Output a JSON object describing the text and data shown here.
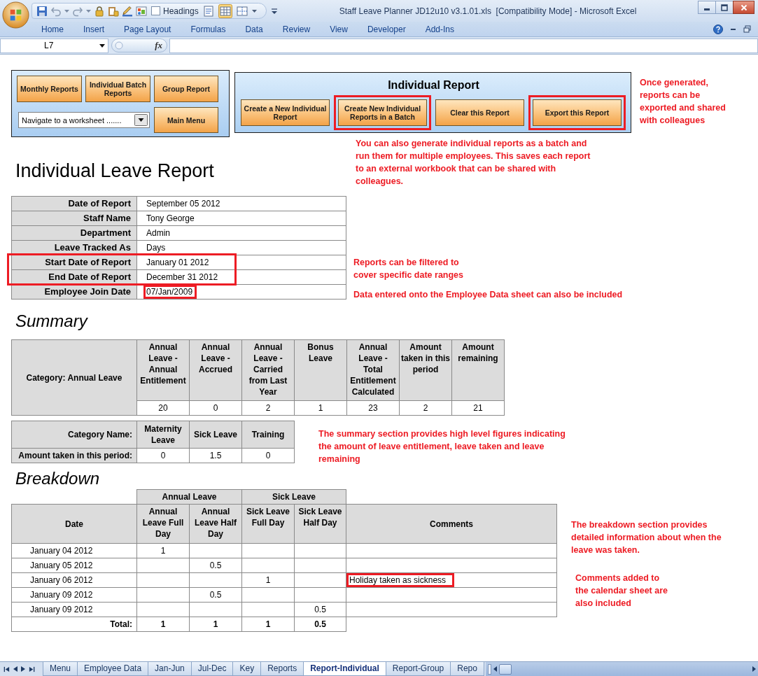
{
  "window": {
    "title": "Staff Leave Planner JD12u10 v3.1.01.xls  [Compatibility Mode] - Microsoft Excel"
  },
  "quick_access": {
    "headings": {
      "label": "Headings",
      "checked": false
    },
    "views": [
      {
        "kind": "page-layout",
        "selected": false
      },
      {
        "kind": "normal",
        "selected": true
      },
      {
        "kind": "page-break",
        "selected": false
      }
    ]
  },
  "ribbon_tabs": [
    {
      "label": "Home",
      "selected": false
    },
    {
      "label": "Insert",
      "selected": false
    },
    {
      "label": "Page Layout",
      "selected": false
    },
    {
      "label": "Formulas",
      "selected": false
    },
    {
      "label": "Data",
      "selected": false
    },
    {
      "label": "Review",
      "selected": false
    },
    {
      "label": "View",
      "selected": false
    },
    {
      "label": "Developer",
      "selected": false
    },
    {
      "label": "Add-Ins",
      "selected": false
    }
  ],
  "formula_bar": {
    "name_box": "L7",
    "function_label": "fx"
  },
  "navigation_panel": {
    "buttons": [
      "Monthly Reports",
      "Individual Batch Reports",
      "Group Report"
    ],
    "worksheet_dropdown": {
      "value": "Navigate to a worksheet ......."
    },
    "main_menu_button": "Main Menu"
  },
  "report_panel": {
    "title": "Individual Report",
    "buttons": [
      {
        "label": "Create a New Individual Report",
        "highlighted": false
      },
      {
        "label": "Create New Individual Reports in a Batch",
        "highlighted": true
      },
      {
        "label": "Clear this Report",
        "highlighted": false
      },
      {
        "label": "Export this Report",
        "highlighted": true
      }
    ]
  },
  "export_note": "Once generated, reports can be exported and shared with colleagues",
  "report_heading": "Individual Leave Report",
  "batch_note": "You can also generate individual reports as a batch and run them for multiple employees. This saves each report to an external workbook that can be shared with colleagues.",
  "details": {
    "rows": [
      {
        "label": "Date of Report",
        "value": "September 05 2012",
        "highlighted": false,
        "value_highlighted": false
      },
      {
        "label": "Staff Name",
        "value": "Tony George",
        "highlighted": false,
        "value_highlighted": false
      },
      {
        "label": "Department",
        "value": "Admin",
        "highlighted": false,
        "value_highlighted": false
      },
      {
        "label": "Leave Tracked As",
        "value": "Days",
        "highlighted": false,
        "value_highlighted": false
      },
      {
        "label": "Start Date of Report",
        "value": "January 01 2012",
        "highlighted": true,
        "value_highlighted": false
      },
      {
        "label": "End Date of Report",
        "value": "December 31 2012",
        "highlighted": true,
        "value_highlighted": false
      },
      {
        "label": "Employee Join Date",
        "value": "07/Jan/2009",
        "highlighted": false,
        "value_highlighted": true
      }
    ],
    "notes": [
      "Reports can be filtered to cover specific date ranges",
      "Data entered onto the Employee Data sheet can also be included"
    ]
  },
  "summary": {
    "title": "Summary",
    "annual_leave": {
      "category": "Category: Annual Leave",
      "columns": [
        {
          "label": "Annual Leave - Annual Entitlement",
          "value": "20"
        },
        {
          "label": "Annual Leave - Accrued",
          "value": "0"
        },
        {
          "label": "Annual Leave - Carried from Last Year",
          "value": "2"
        },
        {
          "label": "Bonus Leave",
          "value": "1"
        },
        {
          "label": "Annual Leave - Total Entitlement Calculated",
          "value": "23"
        },
        {
          "label": "Amount taken in this period",
          "value": "2"
        },
        {
          "label": "Amount remaining",
          "value": "21"
        }
      ]
    },
    "other_leave": {
      "header_label": "Category Name:",
      "row_label": "Amount taken in this period:",
      "columns": [
        {
          "label": "Maternity Leave",
          "value": "0"
        },
        {
          "label": "Sick Leave",
          "value": "1.5"
        },
        {
          "label": "Training",
          "value": "0"
        }
      ]
    },
    "note": "The summary section provides high level figures indicating the amount of leave entitlement, leave taken and leave remaining"
  },
  "breakdown": {
    "title": "Breakdown",
    "date_header": "Date",
    "groups": [
      {
        "label": "Annual Leave",
        "columns": [
          "Annual Leave Full Day",
          "Annual Leave Half Day"
        ]
      },
      {
        "label": "Sick Leave",
        "columns": [
          "Sick Leave Full Day",
          "Sick Leave Half Day"
        ]
      }
    ],
    "comments_header": "Comments",
    "rows": [
      {
        "date": "January 04 2012",
        "annual_leave_full_day": "1",
        "highlighted": false
      },
      {
        "date": "January 05 2012",
        "annual_leave_half_day": "0.5",
        "highlighted": false
      },
      {
        "date": "January 06 2012",
        "sick_leave_full_day": "1",
        "comment": "Holiday taken as sickness",
        "highlighted": true
      },
      {
        "date": "January 09 2012",
        "annual_leave_half_day": "0.5",
        "highlighted": false
      },
      {
        "date": "January 09 2012",
        "sick_leave_half_day": "0.5",
        "highlighted": false
      }
    ],
    "total": {
      "label": "Total:",
      "annual_leave_full_day": "1",
      "annual_leave_half_day": "1",
      "sick_leave_full_day": "1",
      "sick_leave_half_day": "0.5"
    },
    "notes": [
      "The breakdown section provides detailed information about when the leave was taken.",
      "Comments added to the calendar sheet are also included"
    ]
  },
  "sheet_tabs": [
    {
      "label": "Menu",
      "selected": false
    },
    {
      "label": "Employee Data",
      "selected": false
    },
    {
      "label": "Jan-Jun",
      "selected": false
    },
    {
      "label": "Jul-Dec",
      "selected": false
    },
    {
      "label": "Key",
      "selected": false
    },
    {
      "label": "Reports",
      "selected": false
    },
    {
      "label": "Report-Individual",
      "selected": true
    },
    {
      "label": "Report-Group",
      "selected": false
    },
    {
      "label": "Repo",
      "selected": false
    }
  ]
}
